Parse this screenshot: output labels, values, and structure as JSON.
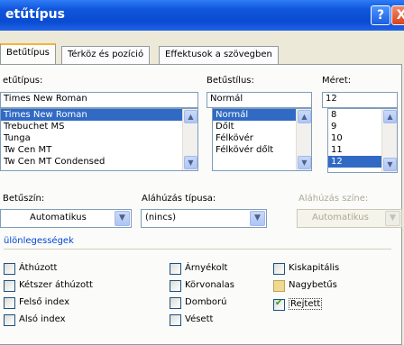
{
  "window": {
    "title": "etűtípus",
    "help_glyph": "?",
    "close_glyph": "X"
  },
  "tabs": [
    {
      "label": "Betűtípus"
    },
    {
      "label": "Térköz és pozíció"
    },
    {
      "label": "Effektusok a szövegben"
    }
  ],
  "font": {
    "label": "etűtípus:",
    "value": "Times New Roman",
    "items": [
      "Times New Roman",
      "Trebuchet MS",
      "Tunga",
      "Tw Cen MT",
      "Tw Cen MT Condensed"
    ],
    "selected_index": 0
  },
  "style": {
    "label": "Betűstílus:",
    "value": "Normál",
    "items": [
      "Normál",
      "Dőlt",
      "Félkövér",
      "Félkövér dőlt"
    ],
    "selected_index": 0
  },
  "size": {
    "label": "Méret:",
    "value": "12",
    "items": [
      "8",
      "9",
      "10",
      "11",
      "12"
    ],
    "selected_index": 4
  },
  "font_color": {
    "label": "Betűszín:",
    "value": "Automatikus"
  },
  "underline_type": {
    "label": "Aláhúzás típusa:",
    "value": "(nincs)"
  },
  "underline_color": {
    "label": "Aláhúzás színe:",
    "value": "Automatikus"
  },
  "effects": {
    "title": "ülönlegességek",
    "items": [
      {
        "label": "Áthúzott",
        "checked": false
      },
      {
        "label": "Kétszer áthúzott",
        "checked": false
      },
      {
        "label": "Felső index",
        "checked": false
      },
      {
        "label": "Alsó index",
        "checked": false
      },
      {
        "label": "Árnyékolt",
        "checked": false
      },
      {
        "label": "Körvonalas",
        "checked": false
      },
      {
        "label": "Domború",
        "checked": false
      },
      {
        "label": "Vésett",
        "checked": false
      },
      {
        "label": "Kiskapitális",
        "checked": false
      },
      {
        "label": "Nagybetűs",
        "checked": false
      },
      {
        "label": "Rejtett",
        "checked": true
      }
    ]
  }
}
